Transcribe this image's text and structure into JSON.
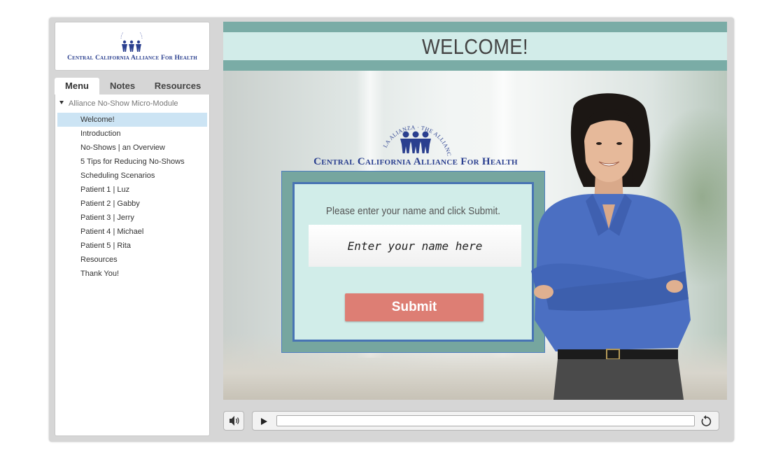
{
  "sidebar": {
    "logo": {
      "org_name": "Central California Alliance For Health",
      "tagline": "La Alianza · The Alliance"
    },
    "tabs": [
      {
        "label": "Menu",
        "active": true
      },
      {
        "label": "Notes",
        "active": false
      },
      {
        "label": "Resources",
        "active": false
      }
    ],
    "menu": {
      "root_label": "Alliance No-Show Micro-Module",
      "items": [
        {
          "label": "Welcome!",
          "selected": true
        },
        {
          "label": "Introduction"
        },
        {
          "label": "No-Shows | an Overview"
        },
        {
          "label": "5 Tips for Reducing No-Shows"
        },
        {
          "label": "Scheduling Scenarios"
        },
        {
          "label": "Patient 1 | Luz"
        },
        {
          "label": "Patient 2 | Gabby"
        },
        {
          "label": "Patient 3 | Jerry"
        },
        {
          "label": "Patient 4 | Michael"
        },
        {
          "label": "Patient 5 | Rita"
        },
        {
          "label": "Resources"
        },
        {
          "label": "Thank You!"
        }
      ]
    }
  },
  "slide": {
    "title": "WELCOME!",
    "logo": {
      "org_name": "Central California Alliance For Health",
      "tagline": "La Alianza · The Alliance"
    },
    "form": {
      "prompt": "Please enter your name and click Submit.",
      "name_placeholder": "Enter your name here",
      "name_value": "",
      "submit_label": "Submit"
    }
  },
  "controls": {
    "icons": [
      "volume-icon",
      "play-icon",
      "replay-icon"
    ],
    "progress": 0
  },
  "colors": {
    "teal_stripe": "#7aaca6",
    "teal_light": "#d2ece9",
    "form_border_blue": "#4874b4",
    "submit_bg": "#dd7e74",
    "menu_selected": "#cce4f4",
    "logo_blue": "#2a3f8f"
  }
}
